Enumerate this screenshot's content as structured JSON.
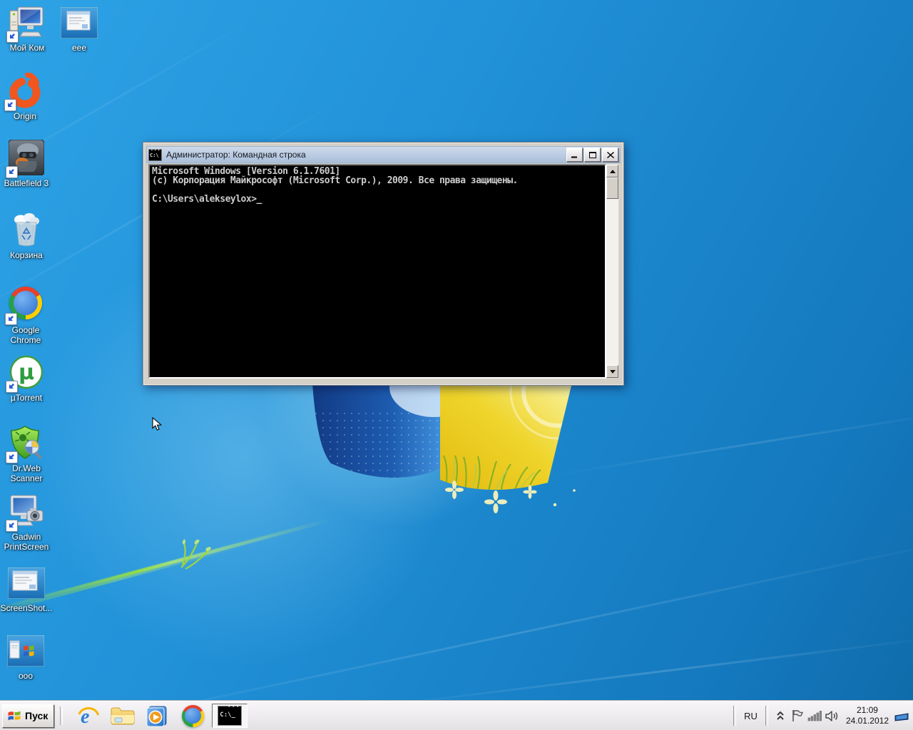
{
  "desktop": {
    "icons": [
      {
        "label": "Мой Ком",
        "name": "my-computer",
        "shortcut": true
      },
      {
        "label": "eee",
        "name": "eee",
        "shortcut": false
      },
      {
        "label": "Origin",
        "name": "origin",
        "shortcut": true
      },
      {
        "label": "Battlefield 3",
        "name": "battlefield3",
        "shortcut": true
      },
      {
        "label": "Корзина",
        "name": "recycle-bin",
        "shortcut": false
      },
      {
        "label": "Google Chrome",
        "name": "google-chrome",
        "shortcut": true
      },
      {
        "label": "µTorrent",
        "name": "utorrent",
        "shortcut": true
      },
      {
        "label": "Dr.Web Scanner",
        "name": "drweb-scanner",
        "shortcut": true
      },
      {
        "label": "Gadwin PrintScreen",
        "name": "gadwin-printscreen",
        "shortcut": true
      },
      {
        "label": "ScreenShot...",
        "name": "screenshot",
        "shortcut": false
      },
      {
        "label": "ooo",
        "name": "ooo",
        "shortcut": false
      }
    ]
  },
  "window": {
    "title": "Администратор: Командная строка",
    "icon": "cmd-icon",
    "controls": [
      "minimize",
      "maximize",
      "close"
    ],
    "console_lines": [
      "Microsoft Windows [Version 6.1.7601]",
      "(c) Корпорация Майкрософт (Microsoft Corp.), 2009. Все права защищены.",
      "",
      "C:\\Users\\alekseylox>"
    ],
    "cursor_char": "_"
  },
  "taskbar": {
    "start_label": "Пуск",
    "quick_launch": [
      "internet-explorer",
      "windows-explorer",
      "media-player",
      "google-chrome"
    ],
    "open_window_button": "cmd",
    "tray": {
      "language": "RU",
      "icons": [
        "hidden-icons-chevron",
        "action-center-flag",
        "network",
        "volume"
      ],
      "time": "21:09",
      "date": "24.01.2012"
    }
  },
  "colors": {
    "titlebar": "#b6c8e0",
    "console_bg": "#000000",
    "console_text": "#cccccc",
    "taskbar": "#edebee",
    "wallpaper_blue": "#2191d8"
  }
}
